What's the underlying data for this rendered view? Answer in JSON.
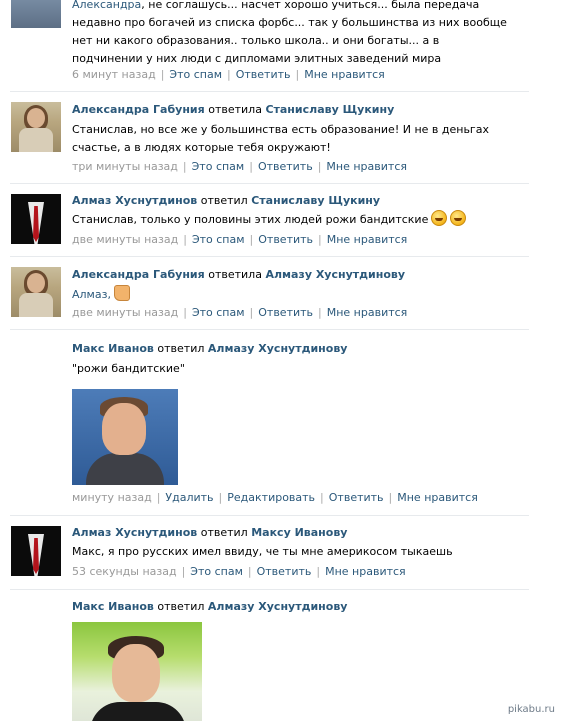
{
  "comments": [
    {
      "text_prefix": "Александра",
      "text": ", не соглашусь... насчет хорошо учиться... была передача недавно про богачей из списка форбс... так у большинства из них вообще нет ни какого образования.. только школа.. и они богаты... а в подчинении у них люди с дипломами элитных заведений мира",
      "time": "6 минут назад",
      "actions": [
        "Это спам",
        "Ответить",
        "Мне нравится"
      ]
    },
    {
      "author": "Александра Габуния",
      "reply_word": "ответила",
      "reply_to": "Станиславу Щукину",
      "text": "Станислав, но все же у большинства есть образование! И не в деньгах счастье, а в людях которые тебя окружают!",
      "time": "три минуты назад",
      "actions": [
        "Это спам",
        "Ответить",
        "Мне нравится"
      ]
    },
    {
      "author": "Алмаз Хуснутдинов",
      "reply_word": "ответил",
      "reply_to": "Станиславу Щукину",
      "text": "Станислав, только у половины этих людей рожи бандитские",
      "time": "две минуты назад",
      "actions": [
        "Это спам",
        "Ответить",
        "Мне нравится"
      ]
    },
    {
      "author": "Александра Габуния",
      "reply_word": "ответила",
      "reply_to": "Алмазу Хуснутдинову",
      "text": "Алмаз,",
      "time": "две минуты назад",
      "actions": [
        "Это спам",
        "Ответить",
        "Мне нравится"
      ]
    },
    {
      "author": "Макс Иванов",
      "reply_word": "ответил",
      "reply_to": "Алмазу Хуснутдинову",
      "text": "\"рожи бандитские\"",
      "time": "минуту назад",
      "actions": [
        "Удалить",
        "Редактировать",
        "Ответить",
        "Мне нравится"
      ]
    },
    {
      "author": "Алмаз Хуснутдинов",
      "reply_word": "ответил",
      "reply_to": "Максу Иванову",
      "text": "Макс, я про русских имел ввиду, че ты мне америкосом тыкаешь",
      "time": "53 секунды назад",
      "actions": [
        "Это спам",
        "Ответить",
        "Мне нравится"
      ]
    },
    {
      "author": "Макс Иванов",
      "reply_word": "ответил",
      "reply_to": "Алмазу Хуснутдинову"
    }
  ],
  "watermark": "pikabu.ru"
}
